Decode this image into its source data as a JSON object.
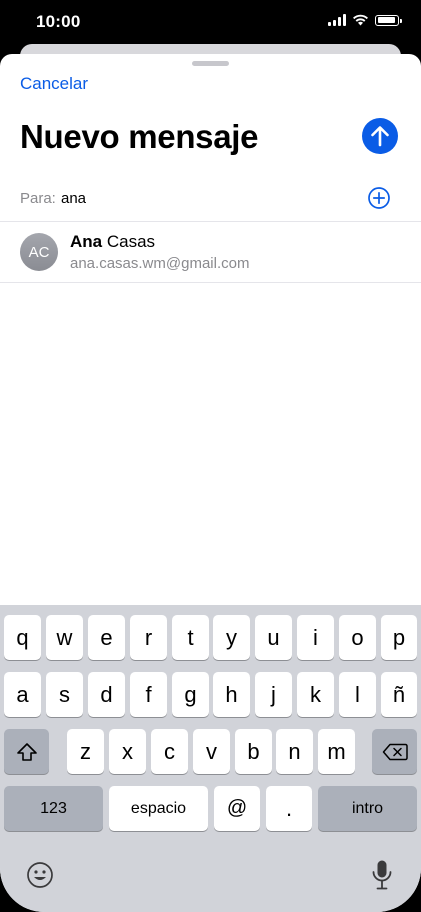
{
  "status_bar": {
    "time": "10:00"
  },
  "header": {
    "cancel_label": "Cancelar",
    "title": "Nuevo mensaje"
  },
  "to_field": {
    "label": "Para:",
    "value": "ana"
  },
  "suggestion": {
    "initials": "AC",
    "name_match": "Ana",
    "name_rest": " Casas",
    "email": "ana.casas.wm@gmail.com"
  },
  "keyboard": {
    "row1": [
      "q",
      "w",
      "e",
      "r",
      "t",
      "y",
      "u",
      "i",
      "o",
      "p"
    ],
    "row2": [
      "a",
      "s",
      "d",
      "f",
      "g",
      "h",
      "j",
      "k",
      "l",
      "ñ"
    ],
    "row3": [
      "z",
      "x",
      "c",
      "v",
      "b",
      "n",
      "m"
    ],
    "numbers_label": "123",
    "space_label": "espacio",
    "at_label": "@",
    "period_label": ".",
    "return_label": "intro"
  },
  "colors": {
    "accent": "#0a5ce6",
    "keyboard_bg": "#d1d3d9",
    "dark_key": "#abb0ba"
  },
  "icons": {
    "send": "arrow-up-icon",
    "add_contact": "plus-circle-icon",
    "shift": "shift-icon",
    "delete": "delete-icon",
    "emoji": "emoji-icon",
    "mic": "microphone-icon"
  }
}
